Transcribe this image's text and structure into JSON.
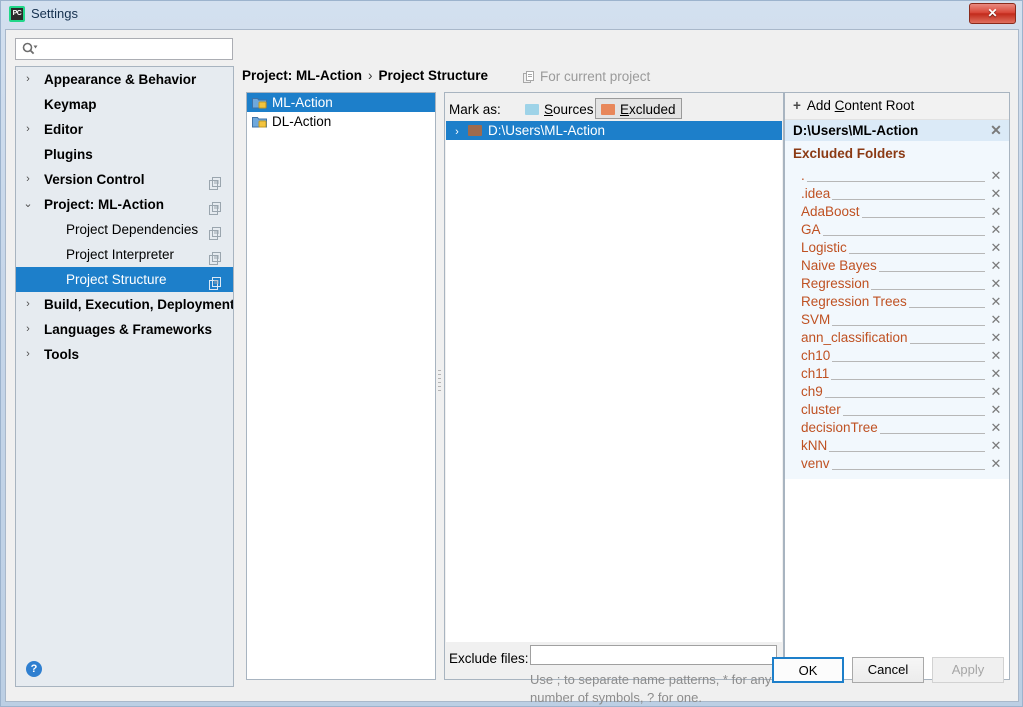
{
  "window": {
    "title": "Settings",
    "app_icon": "pycharm-icon",
    "close_label": "✕"
  },
  "search": {
    "placeholder": "",
    "value": "",
    "icon": "search-icon"
  },
  "sidebar": {
    "items": [
      {
        "label": "Appearance & Behavior",
        "level": 0,
        "arrow": "›",
        "copy": false,
        "selected": false
      },
      {
        "label": "Keymap",
        "level": 0,
        "arrow": "",
        "copy": false,
        "selected": false
      },
      {
        "label": "Editor",
        "level": 0,
        "arrow": "›",
        "copy": false,
        "selected": false
      },
      {
        "label": "Plugins",
        "level": 0,
        "arrow": "",
        "copy": false,
        "selected": false
      },
      {
        "label": "Version Control",
        "level": 0,
        "arrow": "›",
        "copy": true,
        "selected": false
      },
      {
        "label": "Project: ML-Action",
        "level": 0,
        "arrow": "⌄",
        "copy": true,
        "selected": false
      },
      {
        "label": "Project Dependencies",
        "level": 1,
        "arrow": "",
        "copy": true,
        "selected": false
      },
      {
        "label": "Project Interpreter",
        "level": 1,
        "arrow": "",
        "copy": true,
        "selected": false
      },
      {
        "label": "Project Structure",
        "level": 1,
        "arrow": "",
        "copy": true,
        "selected": true
      },
      {
        "label": "Build, Execution, Deployment",
        "level": 0,
        "arrow": "›",
        "copy": false,
        "selected": false
      },
      {
        "label": "Languages & Frameworks",
        "level": 0,
        "arrow": "›",
        "copy": false,
        "selected": false
      },
      {
        "label": "Tools",
        "level": 0,
        "arrow": "›",
        "copy": false,
        "selected": false
      }
    ]
  },
  "header": {
    "crumb1": "Project: ML-Action",
    "separator": "›",
    "crumb2": "Project Structure",
    "for_current_project": "For current project",
    "for_current_icon": "copy-icon"
  },
  "projects": {
    "items": [
      {
        "label": "ML-Action",
        "selected": true
      },
      {
        "label": "DL-Action",
        "selected": false
      }
    ]
  },
  "center": {
    "mark_as_label": "Mark as:",
    "sources_button": {
      "label": "Sources",
      "accel": "S",
      "color": "#9ed3e8",
      "pressed": false
    },
    "excluded_button": {
      "label": "Excluded",
      "accel": "E",
      "color": "#e8875a",
      "pressed": true
    },
    "content_root_row": {
      "arrow": "›",
      "label": "D:\\Users\\ML-Action"
    },
    "exclude_files_label": "Exclude files:",
    "exclude_files_value": "",
    "exclude_files_hint": "Use ; to separate name patterns, * for any number of symbols, ? for one."
  },
  "right": {
    "add_content_root": "Add Content Root",
    "add_accel": "C",
    "plus": "+",
    "root_path": "D:\\Users\\ML-Action",
    "excluded_title": "Excluded Folders",
    "remove_glyph": "✕",
    "excluded_folders": [
      ".",
      ".idea",
      "AdaBoost",
      "GA",
      "Logistic",
      "Naive Bayes",
      "Regression",
      "Regression Trees",
      "SVM",
      "ann_classification",
      "ch10",
      "ch11",
      "ch9",
      "cluster",
      "decisionTree",
      "kNN",
      "venv"
    ]
  },
  "footer": {
    "help": "?",
    "ok": "OK",
    "cancel": "Cancel",
    "apply": "Apply"
  },
  "colors": {
    "selection_blue": "#1d7fca",
    "excluded_orange": "#bf5122",
    "excluded_title": "#8b3a14",
    "panel_bg": "#f0f0f0",
    "excluded_block_bg": "#f2f8fd"
  }
}
